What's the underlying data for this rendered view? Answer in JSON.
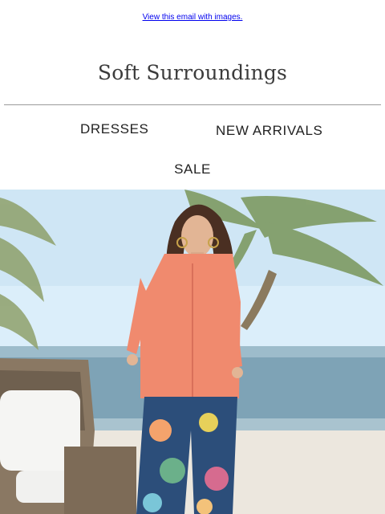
{
  "email": {
    "view_online_link": "View this email with images."
  },
  "header": {
    "logo_text": "Soft Surroundings"
  },
  "nav": {
    "items": [
      {
        "label": "DRESSES"
      },
      {
        "label": "NEW ARRIVALS"
      },
      {
        "label": "SALE"
      }
    ]
  },
  "hero": {
    "image_subject": "model in coral linen shirt and tropical print pants on beach",
    "colors": {
      "sky": "#cfe6f5",
      "sea": "#7ea3b6",
      "sand": "#ece7de",
      "shirt": "#f08a6e"
    }
  }
}
